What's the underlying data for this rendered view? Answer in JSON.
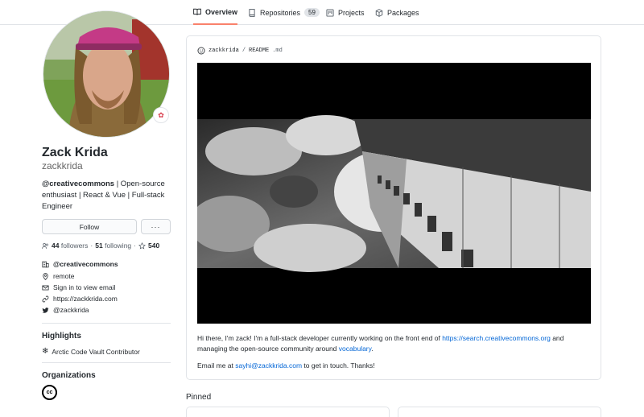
{
  "tabs": [
    {
      "label": "Overview",
      "icon": "book-icon",
      "active": true
    },
    {
      "label": "Repositories",
      "icon": "repo-icon",
      "count": "59"
    },
    {
      "label": "Projects",
      "icon": "project-icon"
    },
    {
      "label": "Packages",
      "icon": "package-icon"
    }
  ],
  "profile": {
    "full_name": "Zack Krida",
    "username": "zackkrida",
    "bio_org": "@creativecommons",
    "bio_rest": " | Open-source enthusiast | React & Vue | Full-stack Engineer",
    "follow_label": "Follow",
    "more_label": "···",
    "followers_count": "44",
    "followers_label": "followers",
    "separator": "·",
    "following_count": "51",
    "following_label": "following",
    "stars_count": "540"
  },
  "details": {
    "organization": "@creativecommons",
    "location": "remote",
    "email": "Sign in to view email",
    "website": "https://zackkrida.com",
    "twitter": "@zackkrida"
  },
  "highlights": {
    "title": "Highlights",
    "item": "Arctic Code Vault Contributor"
  },
  "organizations": {
    "title": "Organizations",
    "logo_text": "cc"
  },
  "readme": {
    "path_user": "zackkrida",
    "path_sep": "/",
    "path_file": "README",
    "path_ext": ".md",
    "p1_a": "Hi there, I'm zack! I'm a full-stack developer currently working on the front end of ",
    "p1_link1": "https://search.creativecommons.org",
    "p1_b": " and managing the open-source community around ",
    "p1_link2": "vocabulary",
    "p1_c": ".",
    "p2_a": "Email me at ",
    "p2_link": "sayhi@zackkrida.com",
    "p2_b": " to get in touch. Thanks!"
  },
  "pinned": {
    "title": "Pinned"
  },
  "colors": {
    "accent_tab": "#f9826c",
    "link": "#0366d6",
    "border": "#e1e4e8"
  }
}
